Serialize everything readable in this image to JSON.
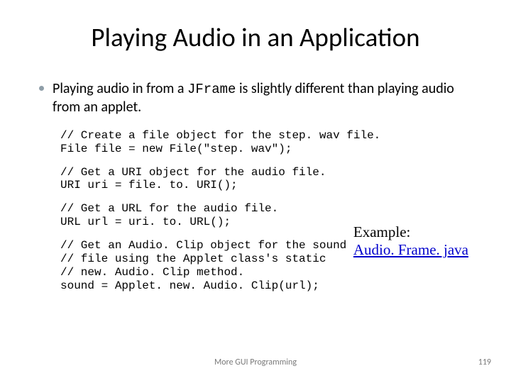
{
  "title": "Playing Audio in an Application",
  "bullet": {
    "pre": "Playing audio in from a ",
    "code": "JFrame",
    "post": " is slightly different than playing audio from an applet."
  },
  "code": {
    "block1": "// Create a file object for the step. wav file.\nFile file = new File(\"step. wav\");",
    "block2": "// Get a URI object for the audio file.\nURI uri = file. to. URI();",
    "block3": "// Get a URL for the audio file.\nURL url = uri. to. URL();",
    "block4": "// Get an Audio. Clip object for the sound\n// file using the Applet class's static\n// new. Audio. Clip method.\nsound = Applet. new. Audio. Clip(url);"
  },
  "example": {
    "label": "Example:",
    "link": "Audio. Frame. java"
  },
  "footer": {
    "center": "More GUI Programming",
    "page": "119"
  }
}
